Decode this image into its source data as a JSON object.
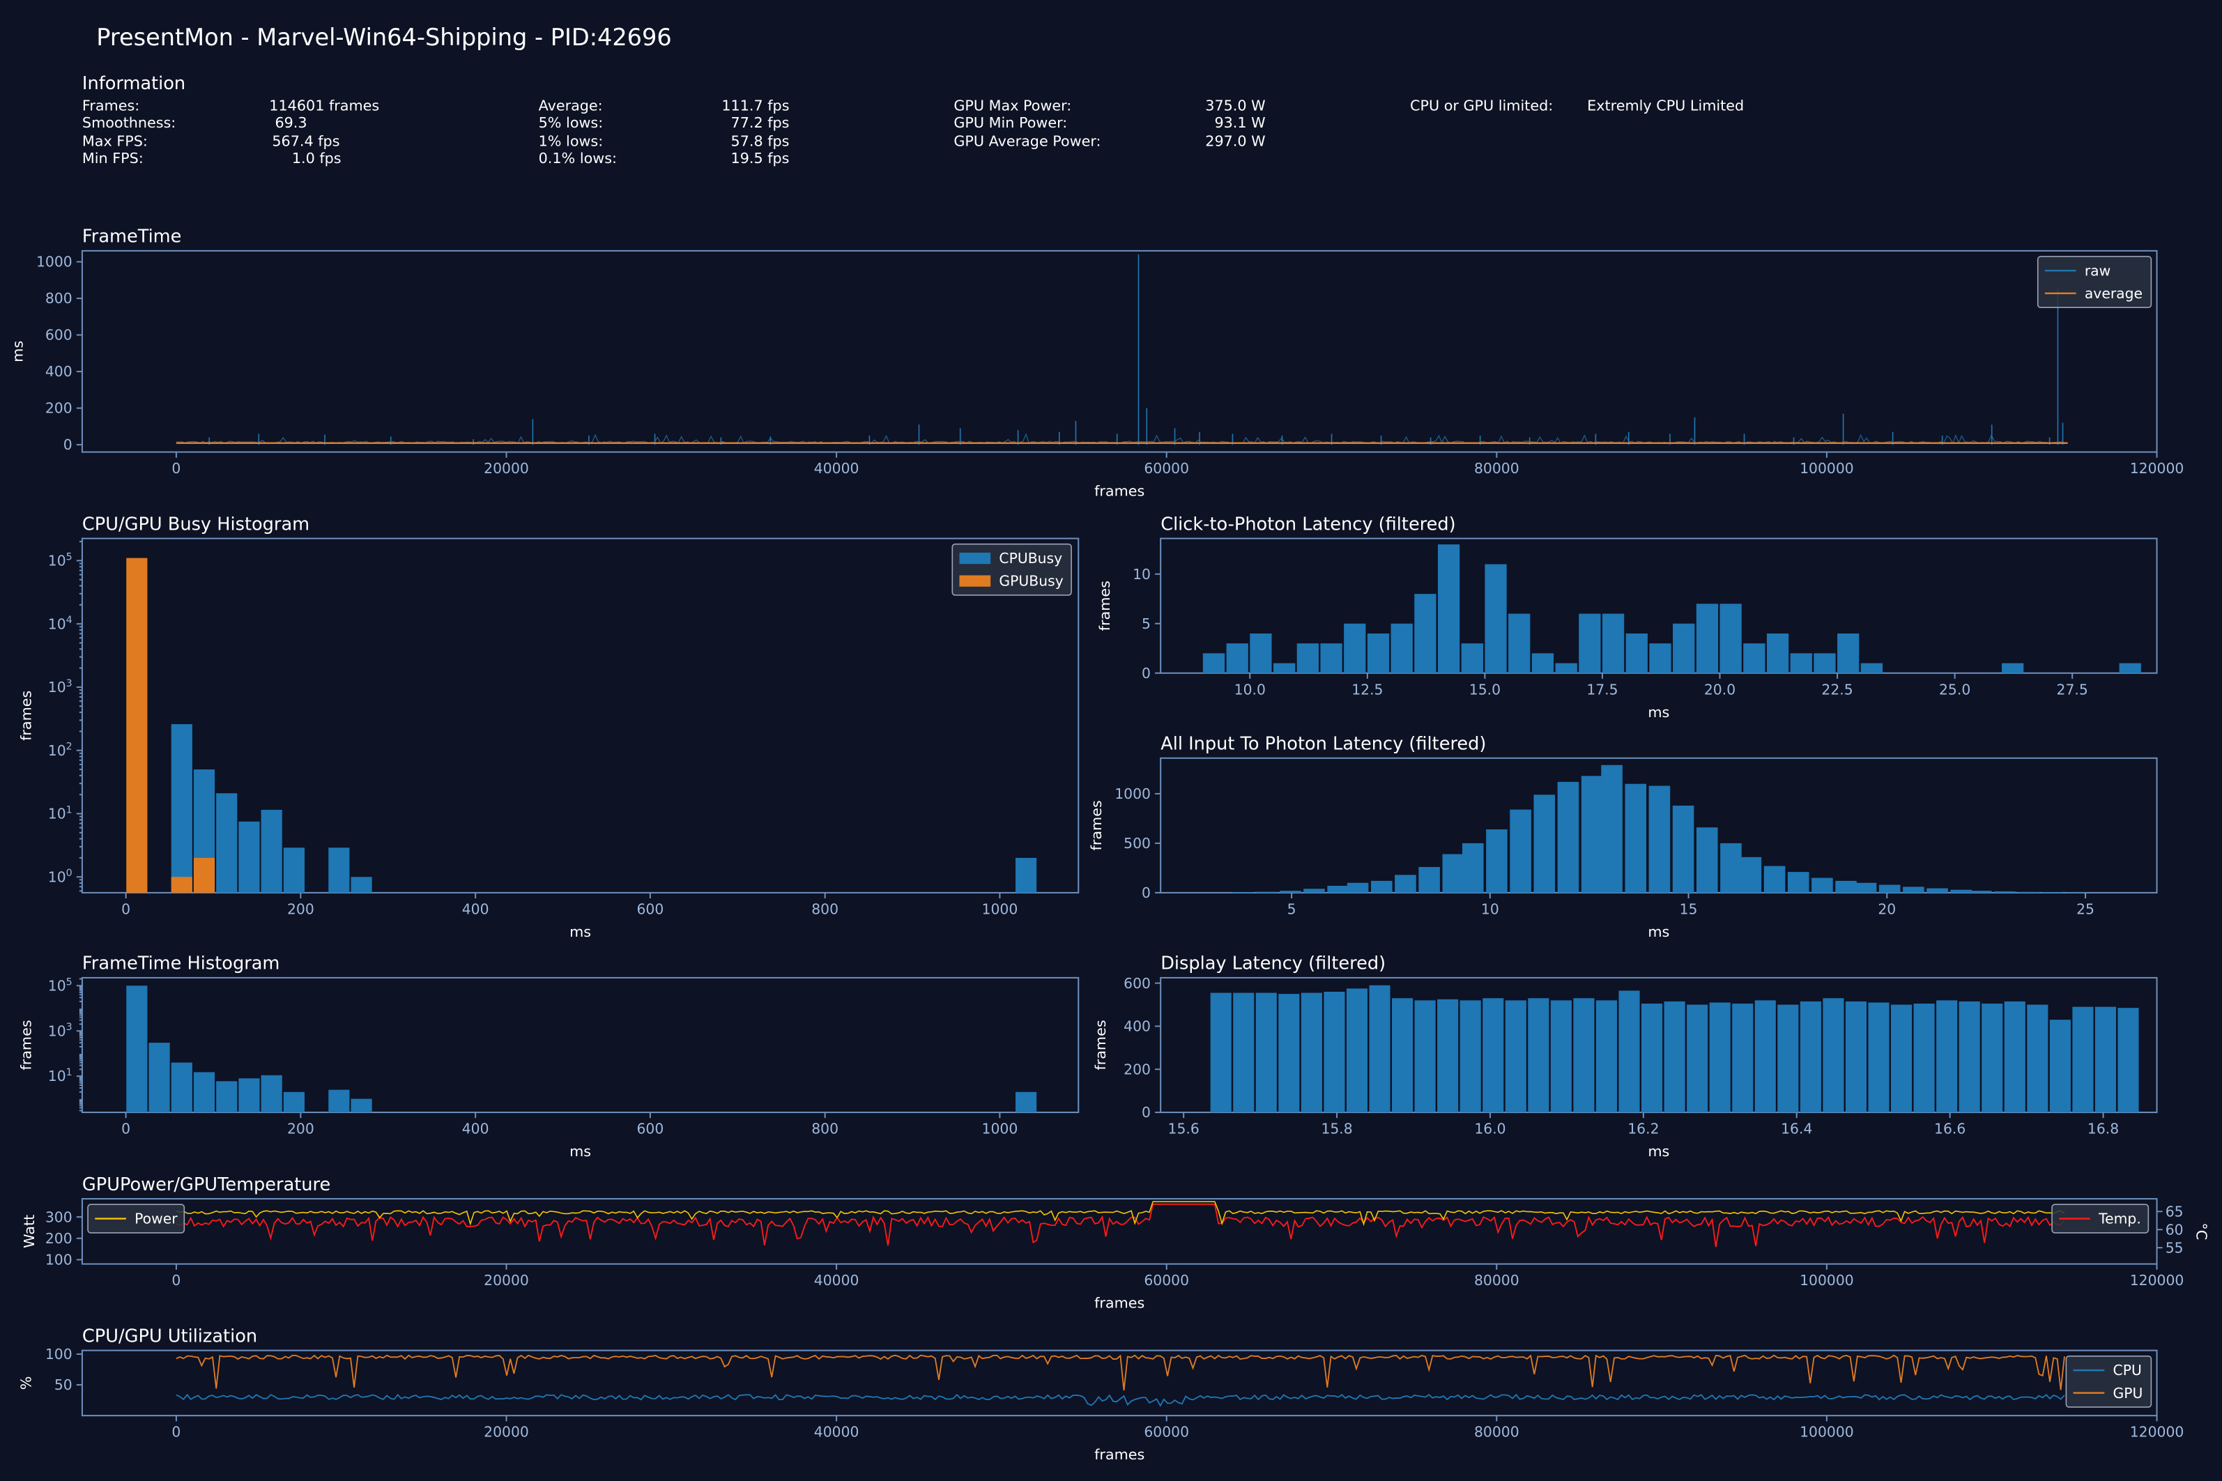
{
  "title": "PresentMon - Marvel-Win64-Shipping - PID:42696",
  "info": {
    "title": "Information",
    "col1_labels": [
      "Frames:",
      "Smoothness:",
      "Max FPS:",
      "Min FPS:"
    ],
    "col1_values": [
      "114601 frames",
      "69.3",
      "567.4 fps",
      "1.0 fps"
    ],
    "col2_labels": [
      "Average:",
      "5% lows:",
      "1% lows:",
      "0.1% lows:"
    ],
    "col2_values": [
      "111.7 fps",
      "77.2 fps",
      "57.8 fps",
      "19.5 fps"
    ],
    "col3_labels": [
      "GPU Max Power:",
      "GPU Min Power:",
      "GPU Average Power:"
    ],
    "col3_values": [
      "375.0 W",
      "93.1 W",
      "297.0 W"
    ],
    "col4_label": "CPU or GPU limited:",
    "col4_value": "Extremly CPU Limited"
  },
  "colors": {
    "background": "#0d1224",
    "axis": "#6d8fbc",
    "tick_text": "#9fb9dd",
    "blue": "#1f77b4",
    "orange": "#e07b22",
    "red": "#ff1a1a",
    "yellow": "#f5c400"
  },
  "chart_data": [
    {
      "id": "frametime",
      "type": "line",
      "title": "FrameTime",
      "xlabel": "frames",
      "ylabel": "ms",
      "xlim": [
        -5700,
        120000
      ],
      "ylim": [
        -40,
        1060
      ],
      "xticks": [
        0,
        20000,
        40000,
        60000,
        80000,
        100000,
        120000
      ],
      "yticks": [
        0,
        200,
        400,
        600,
        800,
        1000
      ],
      "legend": "top-right",
      "series": [
        {
          "name": "raw",
          "color": "#1f77b4",
          "spikes": [
            [
              2000,
              40
            ],
            [
              5000,
              60
            ],
            [
              9000,
              55
            ],
            [
              13000,
              45
            ],
            [
              18000,
              30
            ],
            [
              21600,
              140
            ],
            [
              25000,
              50
            ],
            [
              29000,
              60
            ],
            [
              33000,
              40
            ],
            [
              36000,
              45
            ],
            [
              42000,
              50
            ],
            [
              45000,
              110
            ],
            [
              47500,
              90
            ],
            [
              51000,
              80
            ],
            [
              53500,
              70
            ],
            [
              54500,
              130
            ],
            [
              57000,
              60
            ],
            [
              58300,
              1040
            ],
            [
              58800,
              200
            ],
            [
              60500,
              90
            ],
            [
              62000,
              70
            ],
            [
              64000,
              60
            ],
            [
              67000,
              50
            ],
            [
              70000,
              60
            ],
            [
              73000,
              50
            ],
            [
              76000,
              40
            ],
            [
              79000,
              50
            ],
            [
              82000,
              40
            ],
            [
              86000,
              60
            ],
            [
              88000,
              70
            ],
            [
              90500,
              60
            ],
            [
              92000,
              150
            ],
            [
              95000,
              60
            ],
            [
              98000,
              40
            ],
            [
              101000,
              170
            ],
            [
              104000,
              70
            ],
            [
              107000,
              50
            ],
            [
              110000,
              110
            ],
            [
              113500,
              40
            ],
            [
              114000,
              860
            ],
            [
              114300,
              120
            ]
          ],
          "baseline": 9
        },
        {
          "name": "average",
          "color": "#e07b22",
          "value": 9
        }
      ]
    },
    {
      "id": "busy-hist",
      "type": "bar",
      "title": "CPU/GPU Busy Histogram",
      "xlabel": "ms",
      "ylabel": "frames",
      "yscale": "log",
      "xlim": [
        -50,
        1090
      ],
      "ylim_exp": [
        -0.25,
        5.35
      ],
      "xticks": [
        0,
        200,
        400,
        600,
        800,
        1000
      ],
      "yticks_exp": [
        0,
        1,
        2,
        3,
        4,
        5
      ],
      "legend": "top-right",
      "bin_width": 25.7,
      "series": [
        {
          "name": "CPUBusy",
          "color": "#1f77b4",
          "bars": [
            [
              0.5,
              0
            ],
            [
              26.2,
              0
            ],
            [
              51.9,
              260
            ],
            [
              77.6,
              50
            ],
            [
              103.3,
              21
            ],
            [
              129,
              7.5
            ],
            [
              154.7,
              11.5
            ],
            [
              180.4,
              2.9
            ],
            [
              206.1,
              0
            ],
            [
              231.8,
              2.9
            ],
            [
              257.5,
              1.0
            ],
            [
              1018,
              2.0
            ]
          ]
        },
        {
          "name": "GPUBusy",
          "color": "#e07b22",
          "bars": [
            [
              0.5,
              110000
            ],
            [
              26.2,
              0.0
            ],
            [
              51.9,
              1.0
            ],
            [
              77.6,
              2.0
            ]
          ]
        }
      ]
    },
    {
      "id": "click-to-photon",
      "type": "bar",
      "title": "Click-to-Photon Latency (filtered)",
      "xlabel": "ms",
      "ylabel": "frames",
      "xlim": [
        8.1,
        29.3
      ],
      "ylim": [
        0,
        13.6
      ],
      "xticks": [
        10.0,
        12.5,
        15.0,
        17.5,
        20.0,
        22.5,
        25.0,
        27.5
      ],
      "yticks": [
        0,
        5,
        10
      ],
      "bin_width": 0.5,
      "series": [
        {
          "name": "",
          "color": "#1f77b4",
          "bins": [
            [
              9.0,
              2
            ],
            [
              9.5,
              3
            ],
            [
              10.0,
              4
            ],
            [
              10.5,
              1
            ],
            [
              11.0,
              3
            ],
            [
              11.5,
              3
            ],
            [
              12.0,
              5
            ],
            [
              12.5,
              4
            ],
            [
              13.0,
              5
            ],
            [
              13.5,
              8
            ],
            [
              14.0,
              13
            ],
            [
              14.5,
              3
            ],
            [
              15.0,
              11
            ],
            [
              15.5,
              6
            ],
            [
              16.0,
              2
            ],
            [
              16.5,
              1
            ],
            [
              17.0,
              6
            ],
            [
              17.5,
              6
            ],
            [
              18.0,
              4
            ],
            [
              18.5,
              3
            ],
            [
              19.0,
              5
            ],
            [
              19.5,
              7
            ],
            [
              20.0,
              7
            ],
            [
              20.5,
              3
            ],
            [
              21.0,
              4
            ],
            [
              21.5,
              2
            ],
            [
              22.0,
              2
            ],
            [
              22.5,
              4
            ],
            [
              23.0,
              1
            ],
            [
              26.0,
              1
            ],
            [
              28.5,
              1
            ]
          ]
        }
      ]
    },
    {
      "id": "all-input-photon",
      "type": "bar",
      "title": "All Input To Photon Latency (filtered)",
      "xlabel": "ms",
      "ylabel": "frames",
      "xlim": [
        1.7,
        26.8
      ],
      "ylim": [
        0,
        1360
      ],
      "xticks": [
        5,
        10,
        15,
        20,
        25
      ],
      "yticks": [
        0,
        500,
        1000
      ],
      "bin_width": 0.58,
      "series": [
        {
          "name": "",
          "color": "#1f77b4",
          "bins": [
            [
              3.5,
              5
            ],
            [
              4.1,
              10
            ],
            [
              4.7,
              20
            ],
            [
              5.3,
              40
            ],
            [
              5.9,
              70
            ],
            [
              6.4,
              100
            ],
            [
              7.0,
              120
            ],
            [
              7.6,
              180
            ],
            [
              8.2,
              260
            ],
            [
              8.8,
              390
            ],
            [
              9.3,
              500
            ],
            [
              9.9,
              640
            ],
            [
              10.5,
              840
            ],
            [
              11.1,
              990
            ],
            [
              11.7,
              1120
            ],
            [
              12.3,
              1180
            ],
            [
              12.8,
              1290
            ],
            [
              13.4,
              1100
            ],
            [
              14.0,
              1080
            ],
            [
              14.6,
              880
            ],
            [
              15.2,
              660
            ],
            [
              15.8,
              500
            ],
            [
              16.3,
              360
            ],
            [
              16.9,
              270
            ],
            [
              17.5,
              210
            ],
            [
              18.1,
              150
            ],
            [
              18.7,
              120
            ],
            [
              19.2,
              100
            ],
            [
              19.8,
              80
            ],
            [
              20.4,
              60
            ],
            [
              21.0,
              45
            ],
            [
              21.6,
              30
            ],
            [
              22.1,
              20
            ],
            [
              22.7,
              14
            ],
            [
              23.3,
              8
            ],
            [
              23.9,
              5
            ],
            [
              24.5,
              3
            ]
          ]
        }
      ]
    },
    {
      "id": "frametime-hist",
      "type": "bar",
      "title": "FrameTime Histogram",
      "xlabel": "ms",
      "ylabel": "frames",
      "yscale": "log",
      "xlim": [
        -50,
        1090
      ],
      "ylim_exp": [
        -0.6,
        5.35
      ],
      "xticks": [
        0,
        200,
        400,
        600,
        800,
        1000
      ],
      "yticks_exp": [
        1,
        3,
        5
      ],
      "bin_width": 25.7,
      "series": [
        {
          "name": "",
          "color": "#1f77b4",
          "bars": [
            [
              0.5,
              100000
            ],
            [
              26.2,
              300
            ],
            [
              51.9,
              40
            ],
            [
              77.6,
              15
            ],
            [
              103.3,
              6
            ],
            [
              129,
              8
            ],
            [
              154.7,
              11
            ],
            [
              180.4,
              2
            ],
            [
              206.1,
              0
            ],
            [
              231.8,
              2.5
            ],
            [
              257.5,
              1.0
            ],
            [
              1018,
              2.0
            ]
          ]
        }
      ]
    },
    {
      "id": "display-latency",
      "type": "bar",
      "title": "Display Latency (filtered)",
      "xlabel": "ms",
      "ylabel": "frames",
      "xlim": [
        15.57,
        16.87
      ],
      "ylim": [
        0,
        625
      ],
      "xticks": [
        15.6,
        15.8,
        16.0,
        16.2,
        16.4,
        16.6,
        16.8
      ],
      "yticks": [
        0,
        200,
        400,
        600
      ],
      "bin_width": 0.0296,
      "series": [
        {
          "name": "",
          "color": "#1f77b4",
          "start": 15.635,
          "values": [
            555,
            555,
            555,
            550,
            555,
            560,
            575,
            590,
            530,
            520,
            525,
            520,
            530,
            520,
            530,
            520,
            530,
            520,
            565,
            505,
            515,
            500,
            510,
            505,
            520,
            500,
            515,
            530,
            515,
            510,
            500,
            505,
            520,
            515,
            505,
            515,
            500,
            430,
            490,
            490,
            485
          ]
        }
      ]
    },
    {
      "id": "gpu-power-temp",
      "type": "line",
      "title": "GPUPower/GPUTemperature",
      "xlabel": "frames",
      "ylabel": "Watt",
      "ylabel_right": "°C",
      "xlim": [
        -5700,
        120000
      ],
      "ylim": [
        80,
        385
      ],
      "ylim_right": [
        50.5,
        68.5
      ],
      "xticks": [
        0,
        20000,
        40000,
        60000,
        80000,
        100000,
        120000
      ],
      "yticks": [
        100,
        200,
        300
      ],
      "yticks_right": [
        55,
        60,
        65
      ],
      "series": [
        {
          "name": "Power",
          "color": "#f5c400",
          "legend": "top-left",
          "mean": 315
        },
        {
          "name": "Temp.",
          "color": "#ff1a1a",
          "legend": "top-right",
          "mean_watt_scale": 255
        }
      ]
    },
    {
      "id": "cpu-gpu-util",
      "type": "line",
      "title": "CPU/GPU Utilization",
      "xlabel": "frames",
      "ylabel": "%",
      "xlim": [
        -5700,
        120000
      ],
      "ylim": [
        0,
        106
      ],
      "xticks": [
        0,
        20000,
        40000,
        60000,
        80000,
        100000,
        120000
      ],
      "yticks": [
        50,
        100
      ],
      "legend": "bottom-right",
      "series": [
        {
          "name": "CPU",
          "color": "#1f77b4",
          "mean": 30
        },
        {
          "name": "GPU",
          "color": "#e07b22",
          "mean": 95
        }
      ]
    }
  ]
}
